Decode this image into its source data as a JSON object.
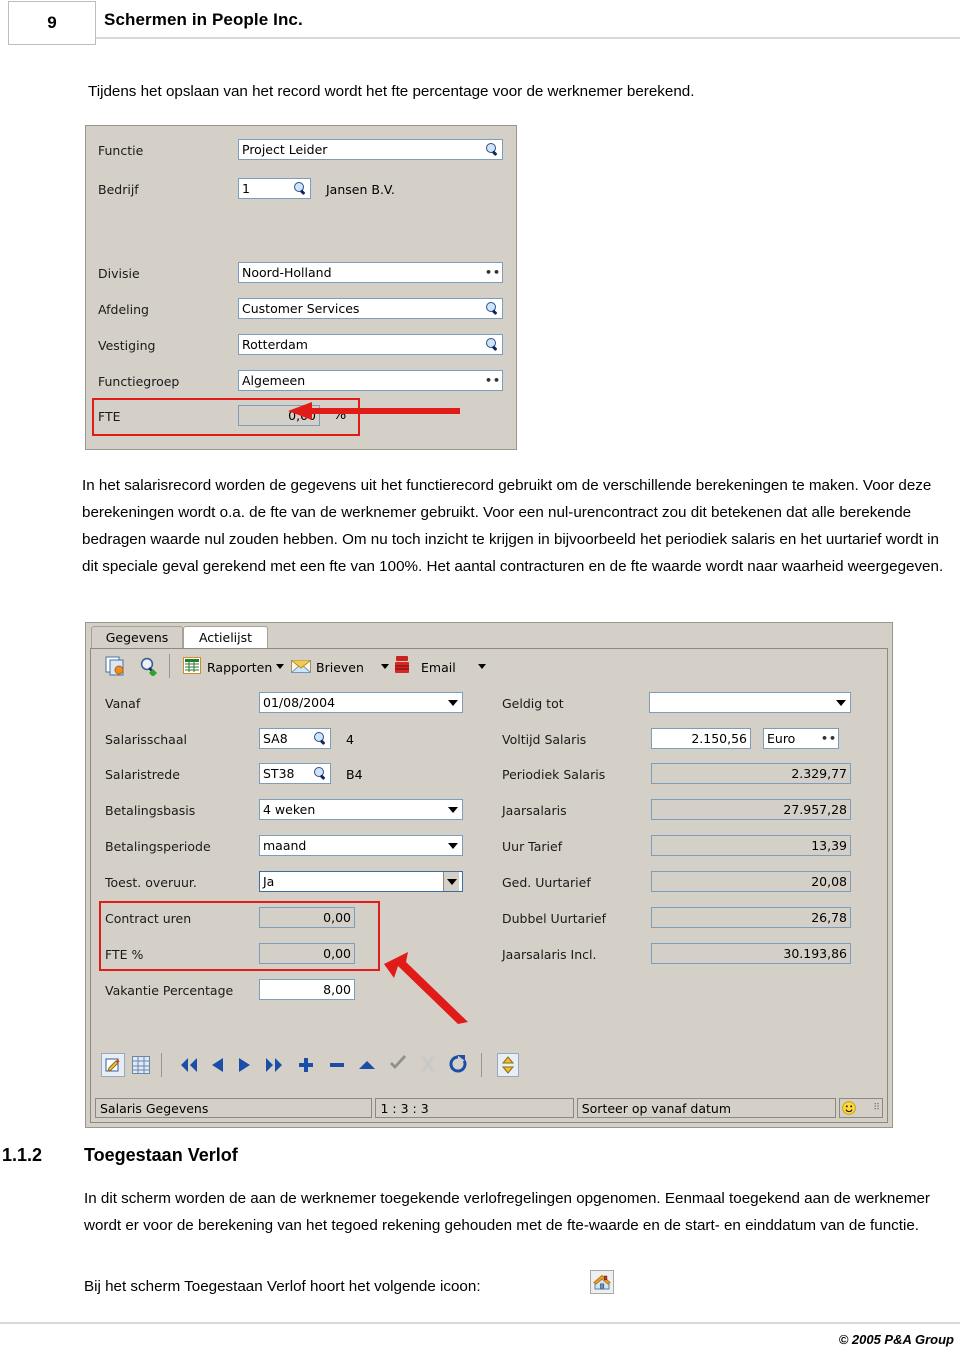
{
  "header": {
    "page_number": "9",
    "title": "Schermen in People Inc."
  },
  "intro_paragraph": "Tijdens het opslaan van het record wordt het fte percentage voor de werknemer berekend.",
  "form1": {
    "fields": [
      {
        "label": "Functie",
        "value": "Project Leider",
        "adorn": "search-icon"
      },
      {
        "label": "Bedrijf",
        "value": "1",
        "adorn": "search-icon",
        "extra": "Jansen B.V."
      },
      {
        "label": "Divisie",
        "value": "Noord-Holland",
        "adorn": "ellipsis"
      },
      {
        "label": "Afdeling",
        "value": "Customer Services",
        "adorn": "search-icon"
      },
      {
        "label": "Vestiging",
        "value": "Rotterdam",
        "adorn": "search-icon"
      },
      {
        "label": "Functiegroep",
        "value": "Algemeen",
        "adorn": "ellipsis"
      },
      {
        "label": "FTE",
        "value": "0,00",
        "adorn": "",
        "suffix": "%"
      }
    ],
    "highlight_color": "#e01b18"
  },
  "body_paragraph": "In het salarisrecord worden de gegevens uit het functierecord gebruikt om de verschillende berekeningen te maken. Voor deze berekeningen wordt o.a. de fte van de werknemer gebruikt. Voor een nul-urencontract zou dit betekenen dat alle berekende bedragen waarde nul zouden hebben. Om nu toch inzicht te krijgen in bijvoorbeeld het periodiek salaris en het uurtarief wordt in dit speciale geval gerekend met een fte van 100%. Het aantal contracturen en de fte waarde wordt naar waarheid weergegeven.",
  "form2": {
    "tabs": [
      {
        "label": "Gegevens",
        "active": true
      },
      {
        "label": "Actielijst",
        "active": false
      }
    ],
    "toolbar": [
      {
        "name": "copy-record-icon",
        "label": ""
      },
      {
        "name": "find-icon",
        "label": ""
      },
      {
        "name": "reports-icon",
        "label": "Rapporten"
      },
      {
        "name": "letters-icon",
        "label": "Brieven"
      },
      {
        "name": "email-icon",
        "label": "Email"
      }
    ],
    "left_fields": [
      {
        "label": "Vanaf",
        "value": "01/08/2004",
        "control": "dropdown"
      },
      {
        "label": "Salarisschaal",
        "value": "SA8",
        "control": "lookup",
        "extra": "4"
      },
      {
        "label": "Salaristrede",
        "value": "ST38",
        "control": "lookup",
        "extra": "B4"
      },
      {
        "label": "Betalingsbasis",
        "value": "4 weken",
        "control": "dropdown"
      },
      {
        "label": "Betalingsperiode",
        "value": "maand",
        "control": "dropdown"
      },
      {
        "label": "Toest. overuur.",
        "value": "Ja",
        "control": "dropdown"
      },
      {
        "label": "Contract uren",
        "value": "0,00",
        "control": "readonly"
      },
      {
        "label": "FTE %",
        "value": "0,00",
        "control": "readonly"
      },
      {
        "label": "Vakantie Percentage",
        "value": "8,00",
        "control": "text"
      }
    ],
    "right_fields": [
      {
        "label": "Geldig tot",
        "value": "",
        "control": "dropdown"
      },
      {
        "label": "Voltijd Salaris",
        "value": "2.150,56",
        "control": "text",
        "currency": "Euro"
      },
      {
        "label": "Periodiek Salaris",
        "value": "2.329,77",
        "control": "readonly"
      },
      {
        "label": "Jaarsalaris",
        "value": "27.957,28",
        "control": "readonly"
      },
      {
        "label": "Uur Tarief",
        "value": "13,39",
        "control": "readonly"
      },
      {
        "label": "Ged. Uurtarief",
        "value": "20,08",
        "control": "readonly"
      },
      {
        "label": "Dubbel Uurtarief",
        "value": "26,78",
        "control": "readonly"
      },
      {
        "label": "Jaarsalaris Incl.",
        "value": "30.193,86",
        "control": "readonly"
      }
    ],
    "nav_buttons": [
      "edit-record-icon",
      "grid-view-icon",
      "first-record-icon",
      "previous-record-icon",
      "next-record-icon",
      "last-record-icon",
      "add-record-icon",
      "delete-record-icon",
      "up-icon",
      "confirm-icon",
      "cancel-icon",
      "refresh-icon",
      "sort-icon"
    ],
    "statusbar": {
      "left": "Salaris Gegevens",
      "counter": "1 : 3 : 3",
      "sort": "Sorteer op vanaf datum",
      "smiley": "smiley-icon"
    }
  },
  "section": {
    "number": "1.1.2",
    "title": "Toegestaan Verlof",
    "paragraph": "In dit scherm worden de aan de werknemer toegekende verlofregelingen opgenomen. Eenmaal toegekend aan de werknemer wordt er voor de berekening van het tegoed rekening gehouden met de fte-waarde en de start- en einddatum van de functie.",
    "icon_line": "Bij het scherm Toegestaan Verlof hoort het volgende icoon:",
    "icon_name": "house-icon"
  },
  "footer": {
    "copyright": "© 2005 P&A Group"
  }
}
